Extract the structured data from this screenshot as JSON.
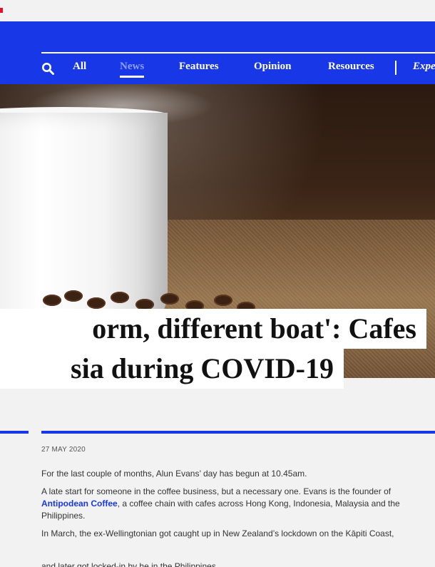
{
  "nav": {
    "search_icon": "search-icon",
    "items": [
      {
        "label": "All",
        "active": false
      },
      {
        "label": "News",
        "active": true
      },
      {
        "label": "Features",
        "active": false
      },
      {
        "label": "Opinion",
        "active": false
      },
      {
        "label": "Resources",
        "active": false
      },
      {
        "label": "Expe",
        "active": false
      }
    ]
  },
  "headline": {
    "line1": "orm, different boat': Cafes",
    "line2": "sia during COVID-19"
  },
  "article": {
    "date": "27 MAY 2020",
    "p1": "For the last couple of months, Alun Evans’ day has begun at 10.45am.",
    "p2_before": "A late start for someone in the coffee business, but a necessary one. Evans is the founder of ",
    "p2_link": "Antipodean Coffee",
    "p2_after": ", a coffee chain with cafes across Hong Kong, Indonesia, Malaysia and the Philippines.",
    "p3": "In March, the ex-Wellingtonian got caught up in New Zealand’s lockdown on the Kāpiti Coast,",
    "p4_cut": "and later got locked-in by he in the Philippines"
  },
  "colors": {
    "brand_blue": "#1838e8",
    "active_nav": "#8ea0ff",
    "accent_red": "#e0112b"
  }
}
